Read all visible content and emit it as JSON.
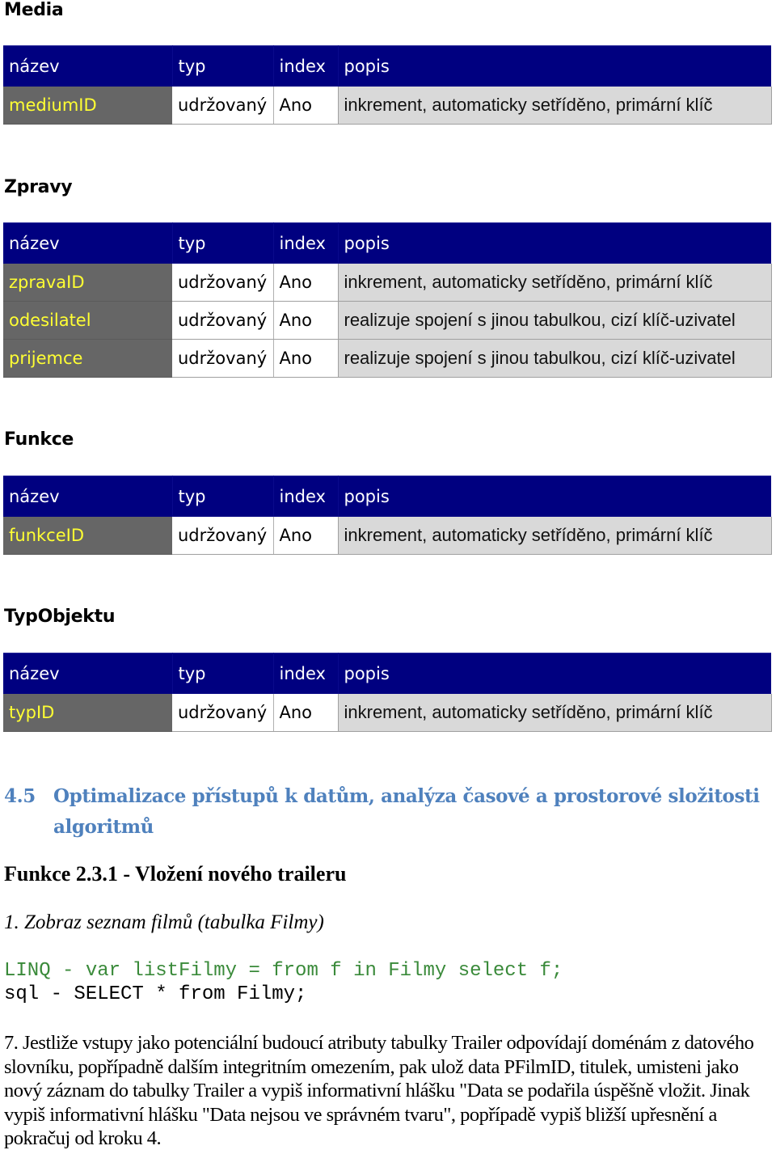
{
  "table_headers": [
    "název",
    "typ",
    "index",
    "popis"
  ],
  "tables": [
    {
      "title": "Media",
      "rows": [
        {
          "name": "mediumID",
          "type": "udržovaný",
          "index": "Ano",
          "desc": "inkrement, automaticky setříděno, primární klíč"
        }
      ]
    },
    {
      "title": "Zpravy",
      "rows": [
        {
          "name": "zpravaID",
          "type": "udržovaný",
          "index": "Ano",
          "desc": "inkrement, automaticky setříděno, primární klíč"
        },
        {
          "name": "odesilatel",
          "type": "udržovaný",
          "index": "Ano",
          "desc": "realizuje spojení s jinou tabulkou, cizí klíč-uzivatel"
        },
        {
          "name": "prijemce",
          "type": "udržovaný",
          "index": "Ano",
          "desc": "realizuje spojení s jinou tabulkou, cizí klíč-uzivatel"
        }
      ]
    },
    {
      "title": "Funkce",
      "rows": [
        {
          "name": "funkceID",
          "type": "udržovaný",
          "index": "Ano",
          "desc": "inkrement, automaticky setříděno, primární klíč"
        }
      ]
    },
    {
      "title": "TypObjektu",
      "rows": [
        {
          "name": "typID",
          "type": "udržovaný",
          "index": "Ano",
          "desc": "inkrement, automaticky setříděno, primární klíč"
        }
      ]
    }
  ],
  "section": {
    "number": "4.5",
    "title_line1": "Optimalizace přístupů k datům, analýza časové a prostorové složitosti",
    "title_line2": "algoritmů"
  },
  "function_title": "Funkce 2.3.1 - Vložení nového traileru",
  "step1": "1. Zobraz seznam filmů (tabulka Filmy)",
  "code": {
    "linq": "LINQ - var listFilmy = from f in Filmy select f;",
    "sql": "sql - SELECT * from Filmy;"
  },
  "step7": "7. Jestliže vstupy jako potenciální budoucí atributy tabulky Trailer odpovídají doménám z datového slovníku, popřípadně dalším integritním omezením, pak ulož data PFilmID, titulek, umisteni jako nový záznam do tabulky Trailer a vypiš informativní hlášku \"Data se podařila úspěšně vložit. Jinak vypiš informativní hlášku \"Data nejsou ve správném tvaru\", popřípadě vypiš bližší upřesnění a pokračuj od kroku 4.",
  "colors": {
    "header_bg": "#000080",
    "name_cell_bg": "#666666",
    "name_text": "#ffff33",
    "desc_cell_bg": "#d9d9d9",
    "section_heading": "#4f81bd",
    "linq_code": "#3a8a3a"
  }
}
